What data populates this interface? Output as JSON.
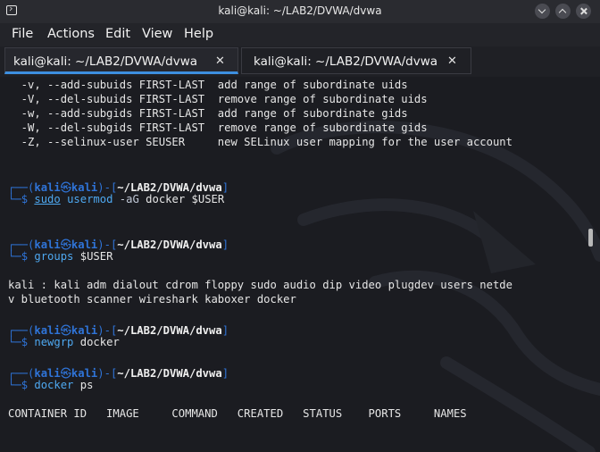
{
  "window": {
    "title": "kali@kali: ~/LAB2/DVWA/dvwa",
    "icon": "terminal-icon"
  },
  "menu": {
    "items": [
      "File",
      "Actions",
      "Edit",
      "View",
      "Help"
    ]
  },
  "tabs": [
    {
      "label": "kali@kali: ~/LAB2/DVWA/dvwa",
      "close": "✕",
      "active": true
    },
    {
      "label": "kali@kali: ~/LAB2/DVWA/dvwa",
      "close": "✕",
      "active": false
    }
  ],
  "terminal": {
    "help_lines": [
      "  -v, --add-subuids FIRST-LAST  add range of subordinate uids",
      "  -V, --del-subuids FIRST-LAST  remove range of subordinate uids",
      "  -w, --add-subgids FIRST-LAST  add range of subordinate gids",
      "  -W, --del-subgids FIRST-LAST  remove range of subordinate gids",
      "  -Z, --selinux-user SEUSER     new SELinux user mapping for the user account"
    ],
    "prompt": {
      "open": "┌──(",
      "user": "kali",
      "at": "㉿",
      "host": "kali",
      "mid": ")-[",
      "cwd": "~/LAB2/DVWA/dvwa",
      "close": "]",
      "second": "└─",
      "dollar": "$"
    },
    "cmd1": {
      "sudo": "sudo",
      "name": "usermod",
      "flags": "-aG",
      "args": "docker $USER"
    },
    "cmd2": {
      "name": "groups",
      "args": "$USER"
    },
    "groups_output": [
      "kali : kali adm dialout cdrom floppy sudo audio dip video plugdev users netde",
      "v bluetooth scanner wireshark kaboxer docker"
    ],
    "cmd3": {
      "name": "newgrp",
      "args": "docker"
    },
    "cmd4": {
      "name": "docker",
      "args": "ps"
    },
    "docker_header": "CONTAINER ID   IMAGE     COMMAND   CREATED   STATUS    PORTS     NAMES"
  }
}
